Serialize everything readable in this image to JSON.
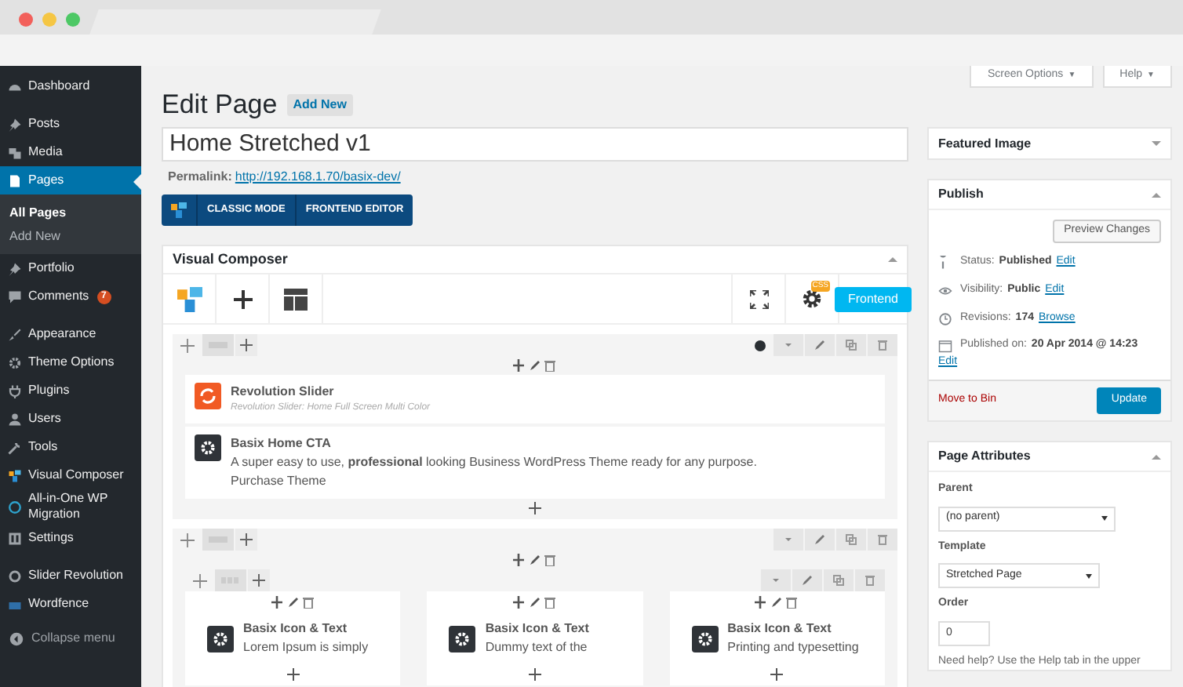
{
  "menu_groups": [
    [
      {
        "label": "Dashboard",
        "selected": false
      }
    ],
    [
      {
        "label": "Posts",
        "selected": false
      },
      {
        "label": "Media",
        "selected": false
      },
      {
        "label": "Pages",
        "selected": true,
        "expanded": true,
        "children": [
          {
            "label": "All Pages",
            "selected": true
          },
          {
            "label": "Add New",
            "selected": false
          }
        ]
      },
      {
        "label": "Portfolio",
        "selected": false
      },
      {
        "label": "Comments",
        "selected": false,
        "badge": "7"
      }
    ],
    [
      {
        "label": "Appearance",
        "selected": false
      },
      {
        "label": "Theme Options",
        "selected": false
      },
      {
        "label": "Plugins",
        "selected": false
      },
      {
        "label": "Users",
        "selected": false
      },
      {
        "label": "Tools",
        "selected": false
      },
      {
        "label": "Visual Composer",
        "selected": false
      },
      {
        "label": "All-in-One WP Migration",
        "selected": false
      },
      {
        "label": "Settings",
        "selected": false
      }
    ],
    [
      {
        "label": "Slider Revolution",
        "selected": false
      },
      {
        "label": "Wordfence",
        "selected": false
      }
    ]
  ],
  "collapse_menu": "Collapse menu",
  "screen_tabs": [
    {
      "label": "Screen Options",
      "caret": "▼"
    },
    {
      "label": "Help",
      "caret": "▼"
    }
  ],
  "heading": "Edit Page",
  "add_new": "Add New",
  "title_field": {
    "value": "Home Stretched v1"
  },
  "permalink": {
    "label": "Permalink:",
    "url": "http://192.168.1.70/basix-dev/"
  },
  "mode_buttons": [
    "CLASSIC MODE",
    "FRONTEND EDITOR"
  ],
  "composer": {
    "title": "Visual Composer",
    "css_badge": "CSS",
    "frontend_button": "Frontend",
    "rows": [
      {
        "kind": "single",
        "color": "#2a2f33",
        "elements": [
          {
            "kind": "slider",
            "title": "Revolution Slider",
            "lines": [
              "Revolution Slider: Home Full Screen Multi Color"
            ]
          },
          {
            "kind": "gear",
            "title": "Basix Home CTA",
            "lines": [
              "A super easy to use, **professional** looking Business WordPress Theme ready for any purpose.",
              "Purchase Theme"
            ]
          }
        ]
      },
      {
        "kind": "columns",
        "columns": [
          {
            "title": "Basix Icon & Text",
            "line": "Lorem Ipsum is simply"
          },
          {
            "title": "Basix Icon & Text",
            "line": "Dummy text of the"
          },
          {
            "title": "Basix Icon & Text",
            "line": "Printing and typesetting"
          }
        ]
      }
    ]
  },
  "featured_image": {
    "title": "Featured Image",
    "expanded": false
  },
  "publish": {
    "title": "Publish",
    "expanded": true,
    "preview_button": "Preview Changes",
    "info": [
      {
        "kind": "status",
        "label": "Status:",
        "value": "Published",
        "link": "Edit"
      },
      {
        "kind": "visibility",
        "label": "Visibility:",
        "value": "Public",
        "link": "Edit"
      },
      {
        "kind": "revisions",
        "label": "Revisions:",
        "value": "174",
        "link": "Browse"
      },
      {
        "kind": "date",
        "label": "Published on:",
        "value": "20 Apr 2014 @ 14:23",
        "link": "Edit"
      }
    ],
    "trash_link": "Move to Bin",
    "update_button": "Update"
  },
  "page_attributes": {
    "title": "Page Attributes",
    "expanded": true,
    "parent_label": "Parent",
    "parent_value": "(no parent)",
    "template_label": "Template",
    "template_value": "Stretched Page",
    "order_label": "Order",
    "order_value": "0",
    "help": "Need help? Use the Help tab in the upper"
  }
}
